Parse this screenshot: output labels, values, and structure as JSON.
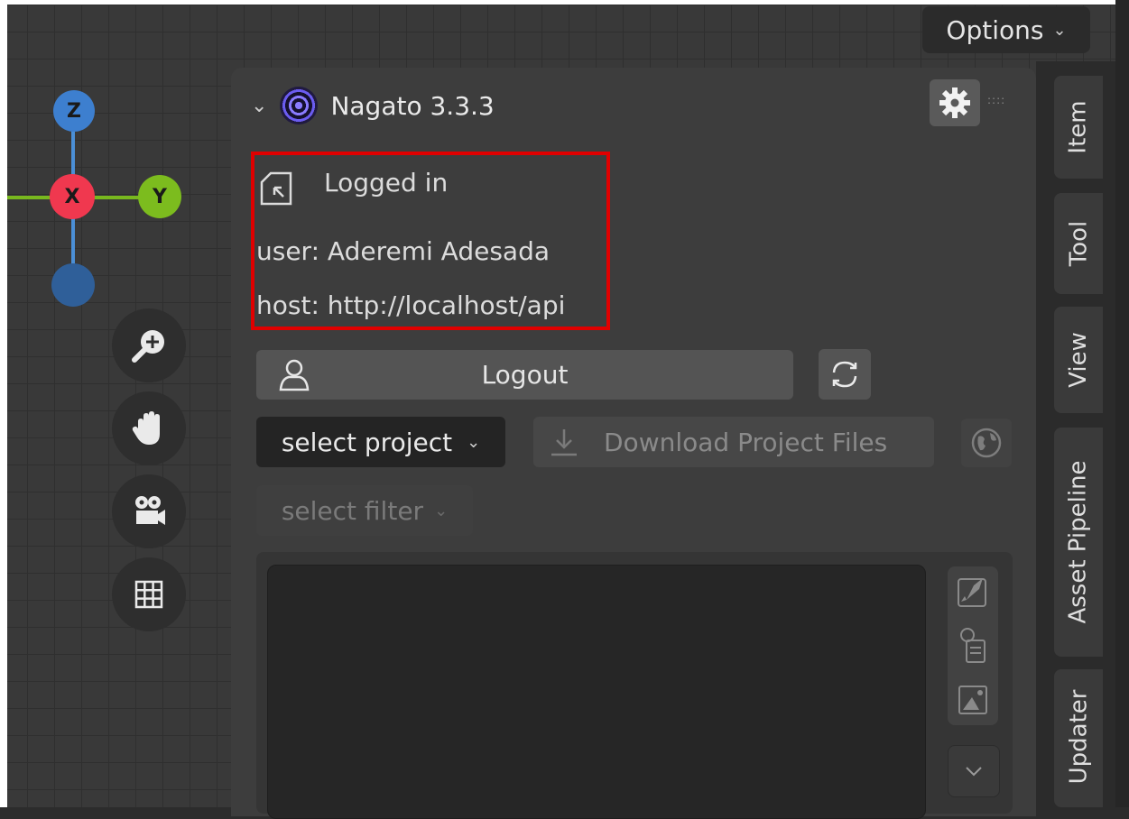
{
  "header": {
    "options_label": "Options"
  },
  "gizmo": {
    "z_label": "Z",
    "x_label": "X",
    "y_label": "Y",
    "colors": {
      "z": "#3d7fcf",
      "x": "#f0384f",
      "y": "#7cbc1e",
      "neg": "#2f5f99"
    }
  },
  "addon": {
    "title": "Nagato 3.3.3",
    "status": {
      "logged_in": "Logged in",
      "user": "user: Aderemi Adesada",
      "host": "host: http://localhost/api"
    },
    "logout_label": "Logout",
    "select_project": "select project",
    "download_label": "Download Project Files",
    "select_filter": "select filter",
    "highlight_color": "#e00000"
  },
  "tabs": [
    "Item",
    "Tool",
    "View",
    "Asset Pipeline",
    "Updater"
  ],
  "icons": {
    "zoom": "zoom-in-icon",
    "pan": "hand-icon",
    "camera": "camera-icon",
    "grid": "grid-icon",
    "gear": "gear-icon",
    "refresh": "refresh-icon",
    "globe": "globe-icon",
    "user": "user-icon",
    "download": "download-icon"
  }
}
